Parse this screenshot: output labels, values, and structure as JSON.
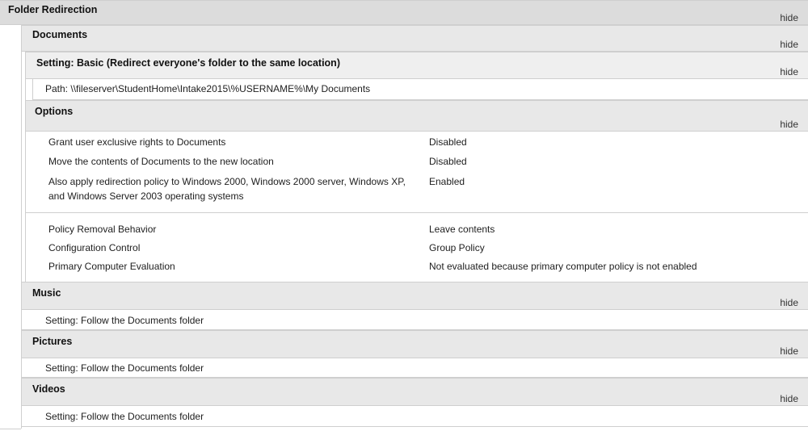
{
  "root": {
    "title": "Folder Redirection",
    "hide": "hide"
  },
  "documents": {
    "title": "Documents",
    "hide": "hide",
    "setting": {
      "title": "Setting: Basic (Redirect everyone's folder to the same location)",
      "hide": "hide"
    },
    "path": "Path: \\\\fileserver\\StudentHome\\Intake2015\\%USERNAME%\\My Documents",
    "options": {
      "title": "Options",
      "hide": "hide",
      "rows": [
        {
          "label": "Grant user exclusive rights to Documents",
          "value": "Disabled"
        },
        {
          "label": "Move the contents of Documents to the new location",
          "value": "Disabled"
        },
        {
          "label": "Also apply redirection policy to Windows 2000, Windows 2000 server, Windows XP,",
          "label2": "and Windows Server 2003 operating systems",
          "value": "Enabled"
        }
      ],
      "rows2": [
        {
          "label": "Policy Removal Behavior",
          "value": "Leave contents"
        },
        {
          "label": "Configuration Control",
          "value": "Group Policy"
        },
        {
          "label": "Primary Computer Evaluation",
          "value": "Not evaluated because primary computer policy is not enabled"
        }
      ]
    }
  },
  "music": {
    "title": "Music",
    "hide": "hide",
    "setting": "Setting: Follow the Documents folder"
  },
  "pictures": {
    "title": "Pictures",
    "hide": "hide",
    "setting": "Setting: Follow the Documents folder"
  },
  "videos": {
    "title": "Videos",
    "hide": "hide",
    "setting": "Setting: Follow the Documents folder"
  }
}
